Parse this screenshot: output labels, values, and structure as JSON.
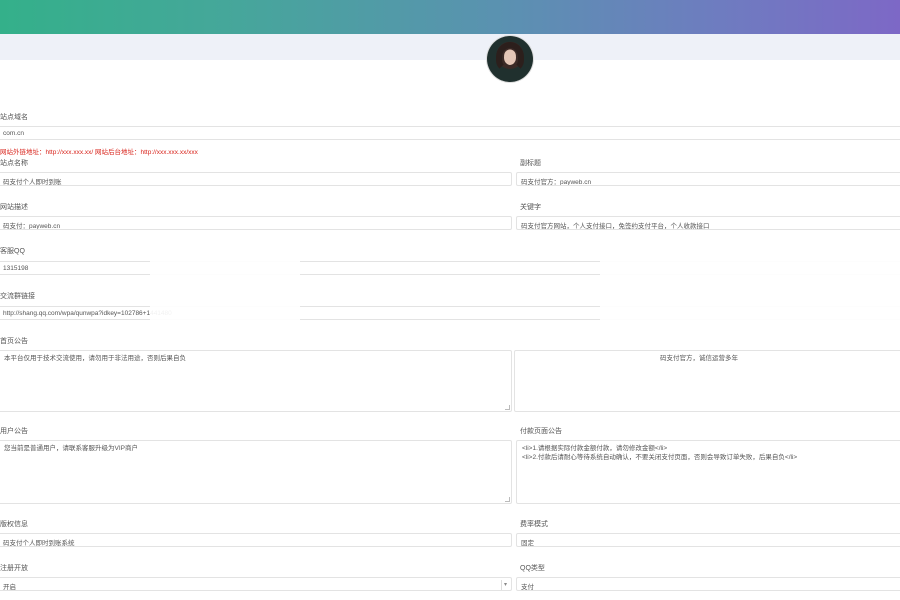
{
  "header": {
    "accent_start": "#34b08a",
    "accent_end": "#7d68c6"
  },
  "notice": "网站外链地址：http://xxx.xxx.xx/ 网站后台地址：http://xxx.xxx.xx/xxx",
  "fields": {
    "site_url_label": "站点域名",
    "site_url_value": "com.cn",
    "site_name_label": "站点名称",
    "site_name_value": "码支付个人即时到账",
    "subtitle_label": "副标题",
    "subtitle_value": "码支付官方：payweb.cn",
    "description_label": "网站描述",
    "description_value": "码支付：payweb.cn",
    "keywords_label": "关键字",
    "keywords_value": "码支付官方网站，个人支付接口，免签约支付平台，个人收款接口",
    "qq_label": "客服QQ",
    "qq_value": "1315198",
    "qq_link_label": "交流群链接",
    "qq_link_value": "http://shang.qq.com/wpa/qunwpa?idkey=102786+1441480",
    "popup_notice_label": "首页公告",
    "popup_notice_value": "本平台仅用于技术交流使用，请勿用于非法用途，否则后果自负",
    "popup_notice_right_value": "码支付官方，诚信运营多年",
    "user_notice_label": "用户公告",
    "user_notice_value": "您当前是普通用户，请联系客服升级为VIP商户",
    "pay_notice_label": "付款页面公告",
    "pay_notice_line1": "<li>1.请根据实际付款金额付款，请勿修改金额</li>",
    "pay_notice_line2": "<li>2.付款后请耐心等待系统自动确认，不要关闭支付页面，否则会导致订单失败，后果自负</li>",
    "copyright_label": "版权信息",
    "copyright_value": "码支付个人即时到账系统",
    "fee_label": "费率模式",
    "fee_value": "固定",
    "login_label": "注册开放",
    "login_value": "开启",
    "qq_type_label": "QQ类型",
    "qq_type_value": "支付"
  }
}
